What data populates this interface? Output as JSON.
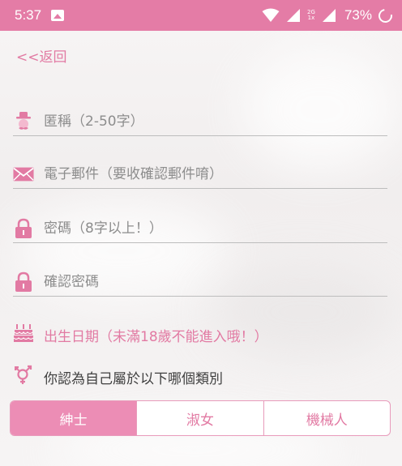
{
  "status_bar": {
    "time": "5:37",
    "network_label_top": "2G",
    "network_label_bottom": "1x",
    "battery_percent": "73%",
    "icons": [
      "gallery-icon",
      "wifi-icon",
      "signal-icon",
      "battery-icon"
    ]
  },
  "nav": {
    "back_label": "<<返回"
  },
  "form": {
    "nickname_placeholder": "匿稱（2-50字）",
    "email_placeholder": "電子郵件（要收確認郵件唷）",
    "password_placeholder": "密碼（8字以上！）",
    "confirm_password_placeholder": "確認密碼",
    "birthday_label": "出生日期（未滿18歲不能進入哦！）",
    "gender_question": "你認為自己屬於以下哪個類別"
  },
  "gender_options": [
    {
      "label": "紳士",
      "selected": true
    },
    {
      "label": "淑女",
      "selected": false
    },
    {
      "label": "機械人",
      "selected": false
    }
  ],
  "colors": {
    "accent": "#e27aa3",
    "status_bar": "#e47ca6",
    "selected_segment": "#ec8db5"
  }
}
